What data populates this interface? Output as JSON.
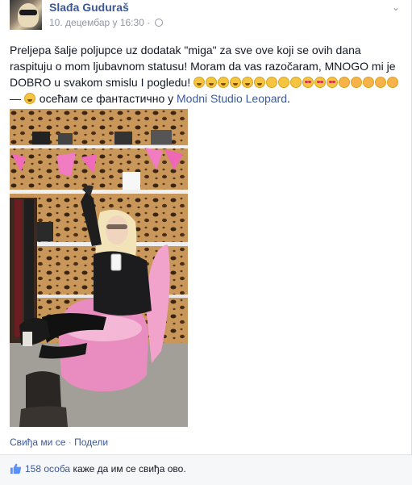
{
  "post": {
    "author": "Slađa Guduraš",
    "timestamp": "10. децембар у 16:30 ·",
    "menu_icon": "chevron-down-icon",
    "privacy_icon": "globe-icon",
    "text_main": "Preljepa šalje poljupce uz dodatak \"miga\" za sve ove koji se ovih dana raspituju o mom ljubavnom statusu! Moram da vas razočaram, MNOGO mi je DOBRO u svakom smislu I pogledu!",
    "feeling_sep": " — ",
    "feeling_text": " осећам се фантастично у ",
    "place_link": "Modni Studio Leopard",
    "place_end": "."
  },
  "photo": {
    "icon": "photo-woman-pink-chair"
  },
  "actions": {
    "like": "Свиђа ми се",
    "sep": " · ",
    "share": "Подели"
  },
  "likes": {
    "icon": "thumbs-up-icon",
    "count": "158 особа",
    "text": " каже да им се свиђа ово."
  },
  "colors": {
    "link": "#3b5998",
    "meta": "#9197a3",
    "text": "#141823"
  }
}
